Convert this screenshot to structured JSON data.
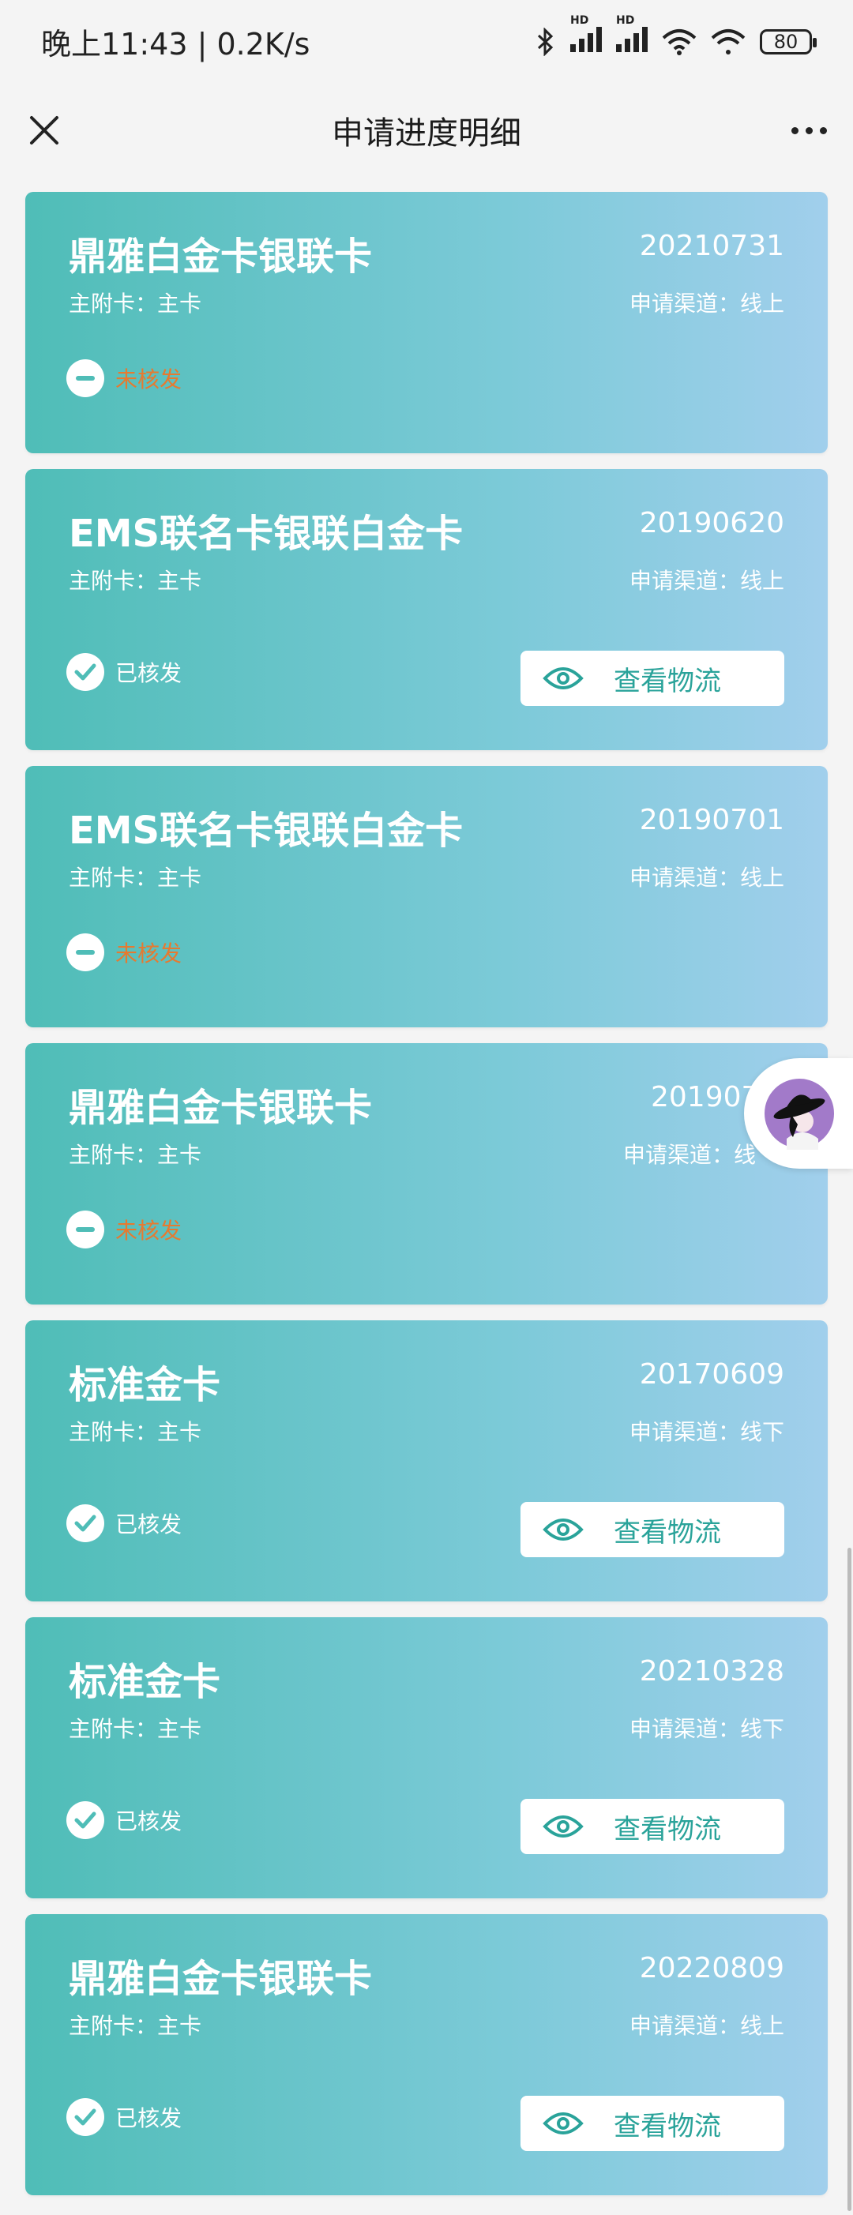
{
  "status_bar": {
    "time_speed": "晚上11:43 | 0.2K/s",
    "hd1": "HD",
    "hd2": "HD",
    "battery": "80"
  },
  "header": {
    "title": "申请进度明细",
    "close_icon": "close-icon",
    "more_icon": "more-icon"
  },
  "cards": [
    {
      "name": "鼎雅白金卡银联卡",
      "date": "20210731",
      "type_label": "主附卡：主卡",
      "channel_label": "申请渠道：线上",
      "status": "未核发",
      "status_kind": "pending"
    },
    {
      "name": "EMS联名卡银联白金卡",
      "date": "20190620",
      "type_label": "主附卡：主卡",
      "channel_label": "申请渠道：线上",
      "status": "已核发",
      "status_kind": "issued",
      "action_label": "查看物流"
    },
    {
      "name": "EMS联名卡银联白金卡",
      "date": "20190701",
      "type_label": "主附卡：主卡",
      "channel_label": "申请渠道：线上",
      "status": "未核发",
      "status_kind": "pending"
    },
    {
      "name": "鼎雅白金卡银联卡",
      "date": "201907",
      "type_label": "主附卡：主卡",
      "channel_label": "申请渠道：线",
      "status": "未核发",
      "status_kind": "pending"
    },
    {
      "name": "标准金卡",
      "date": "20170609",
      "type_label": "主附卡：主卡",
      "channel_label": "申请渠道：线下",
      "status": "已核发",
      "status_kind": "issued",
      "action_label": "查看物流"
    },
    {
      "name": "标准金卡",
      "date": "20210328",
      "type_label": "主附卡：主卡",
      "channel_label": "申请渠道：线下",
      "status": "已核发",
      "status_kind": "issued",
      "action_label": "查看物流"
    },
    {
      "name": "鼎雅白金卡银联卡",
      "date": "20220809",
      "type_label": "主附卡：主卡",
      "channel_label": "申请渠道：线上",
      "status": "已核发",
      "status_kind": "issued",
      "action_label": "查看物流"
    }
  ],
  "colors": {
    "card_gradient_start": "#4fbdb7",
    "card_gradient_end": "#a1cfec",
    "pending": "#e67a30",
    "action_text": "#2aa39a"
  },
  "floating_assistant": {
    "icon": "assistant-avatar-icon"
  }
}
